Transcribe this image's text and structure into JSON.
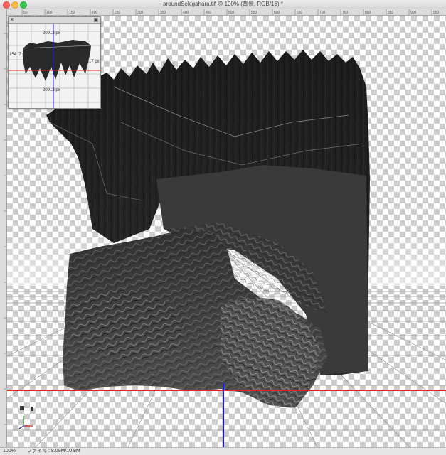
{
  "window": {
    "title": "aroundSekigahara.tif @ 100% (背景, RGB/16) *"
  },
  "ruler": {
    "ticks": [
      "50",
      "100",
      "150",
      "200",
      "250",
      "300",
      "350",
      "400",
      "450",
      "500",
      "550",
      "600",
      "650",
      "700",
      "750",
      "800",
      "850",
      "900",
      "950"
    ]
  },
  "widget": {
    "top_label": "209..3 px",
    "bottom_label": "209..3 px",
    "left_label": "154..7 px",
    "right_label": "154..7 px"
  },
  "statusbar": {
    "zoom": "100%",
    "doc_info": "ファイル : 8.09M/10.8M"
  },
  "colors": {
    "x_axis": "#e0231e",
    "y_axis": "#1a1ae6",
    "terrain": "#2e2e2e"
  }
}
